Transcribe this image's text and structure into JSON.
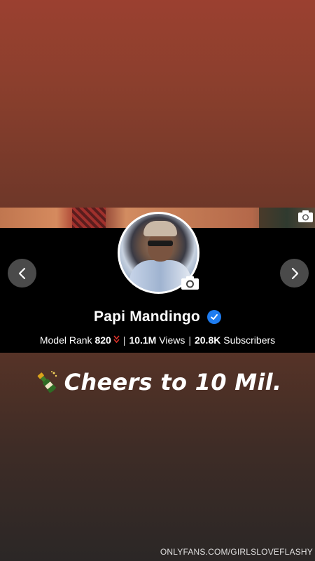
{
  "profile": {
    "name": "Papi Mandingo",
    "verified": true,
    "stats": {
      "rank_label": "Model Rank",
      "rank_value": "820",
      "views_value": "10.1M",
      "views_label": "Views",
      "subscribers_value": "20.8K",
      "subscribers_label": "Subscribers"
    }
  },
  "icons": {
    "cover_camera": "camera-icon",
    "avatar_camera": "camera-icon",
    "prev": "chevron-left-icon",
    "next": "chevron-right-icon",
    "verified": "verified-check-icon",
    "rank_trend": "double-chevron-down-icon",
    "emoji": "champagne-bottle-icon"
  },
  "caption": {
    "text": "Cheers to 10 Mil."
  },
  "watermark": {
    "text": "ONLYFANS.COM/GIRLSLOVEFLASHY"
  },
  "colors": {
    "verified": "#1e7cf0",
    "rank_down": "#e0322b",
    "panel": "#000000",
    "nav_button": "#4a4a4a"
  }
}
